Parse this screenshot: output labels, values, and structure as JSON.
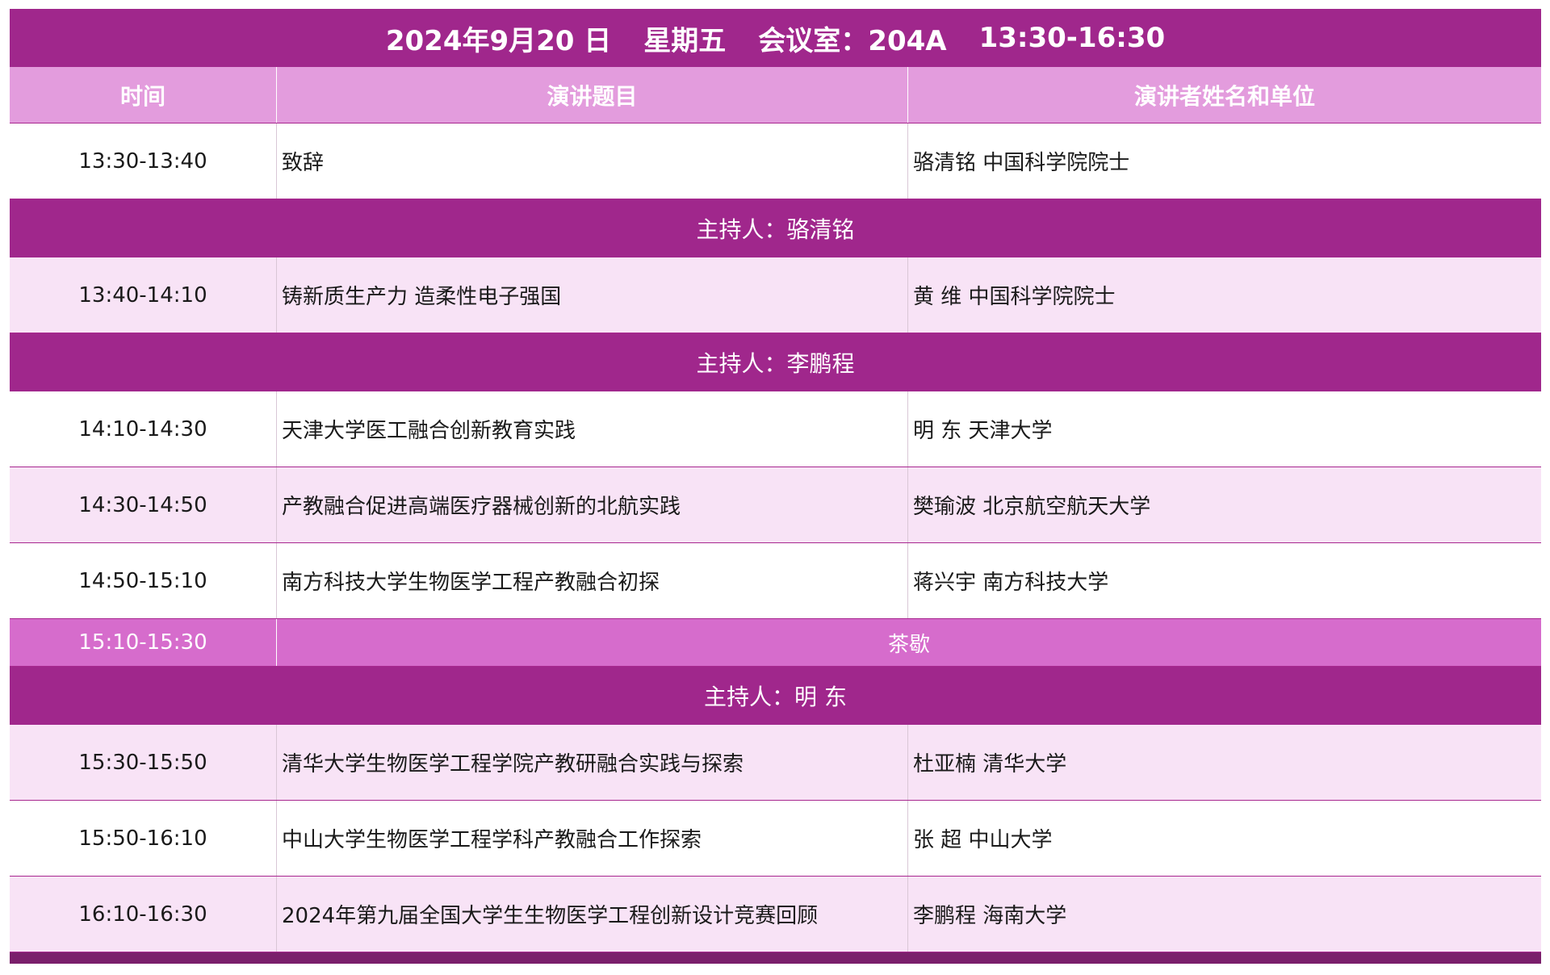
{
  "title": {
    "date": "2024年9月20 日",
    "weekday": "星期五",
    "room": "会议室：204A",
    "time": "13:30-16:30"
  },
  "header": {
    "time": "时间",
    "topic": "演讲题目",
    "speaker": "演讲者姓名和单位"
  },
  "opening": {
    "time": "13:30-13:40",
    "topic": "致辞",
    "speaker": "骆清铭  中国科学院院士"
  },
  "sessions": [
    {
      "host": "主持人：骆清铭",
      "talks": [
        {
          "time": "13:40-14:10",
          "topic": "铸新质生产力 造柔性电子强国",
          "speaker": "黄   维  中国科学院院士"
        }
      ]
    },
    {
      "host": "主持人：李鹏程",
      "talks": [
        {
          "time": "14:10-14:30",
          "topic": "天津大学医工融合创新教育实践",
          "speaker": "明   东  天津大学"
        },
        {
          "time": "14:30-14:50",
          "topic": " 产教融合促进高端医疗器械创新的北航实践",
          "speaker": "樊瑜波  北京航空航天大学"
        },
        {
          "time": "14:50-15:10",
          "topic": "南方科技大学生物医学工程产教融合初探",
          "speaker": "蒋兴宇  南方科技大学"
        }
      ]
    }
  ],
  "break": {
    "time": "15:10-15:30",
    "label": "茶歇"
  },
  "session3": {
    "host": "主持人：明   东",
    "talks": [
      {
        "time": "15:30-15:50",
        "topic": " 清华大学生物医学工程学院产教研融合实践与探索",
        "speaker": "杜亚楠  清华大学"
      },
      {
        "time": "15:50-16:10",
        "topic": "中山大学生物医学工程学科产教融合工作探索",
        "speaker": "张   超  中山大学"
      },
      {
        "time": "16:10-16:30",
        "topic": "2024年第九届全国大学生生物医学工程创新设计竞赛回顾",
        "speaker": "李鹏程  海南大学"
      }
    ]
  }
}
